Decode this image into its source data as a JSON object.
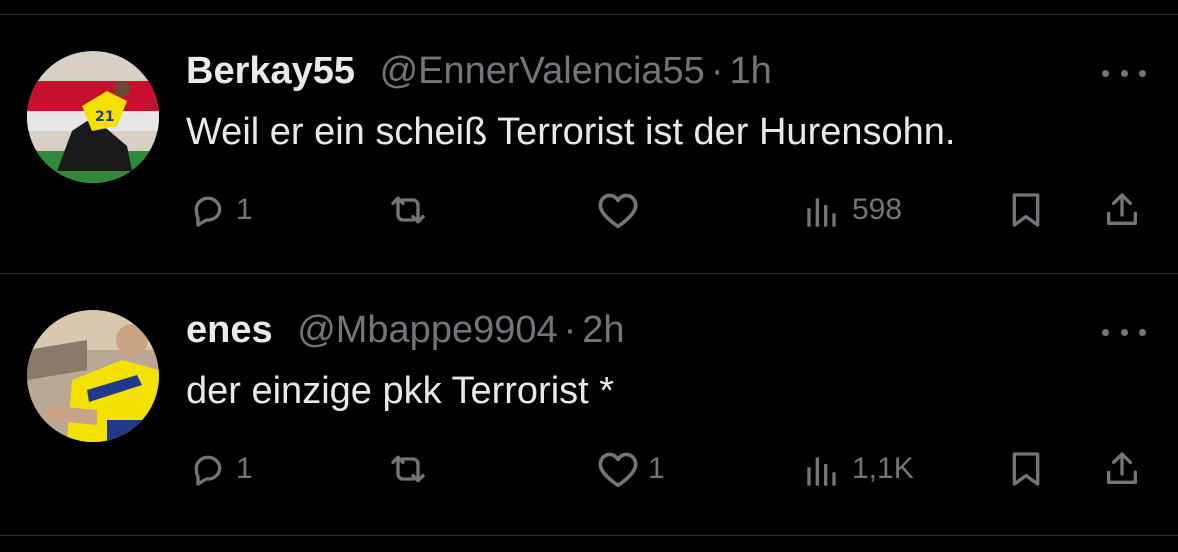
{
  "tweets": [
    {
      "display_name": "Berkay55",
      "handle": "@EnnerValencia55",
      "separator": "·",
      "time": "1h",
      "text": "Weil er ein scheiß Terrorist ist der Hurensohn.",
      "replies": "1",
      "reposts": "",
      "likes": "",
      "views": "598",
      "avatar_colors": [
        "#c8102e",
        "#f5e100",
        "#1a1a1a",
        "#2e8b3a"
      ]
    },
    {
      "display_name": "enes",
      "handle": "@Mbappe9904",
      "separator": "·",
      "time": "2h",
      "text": "der einzige pkk Terrorist *",
      "replies": "1",
      "reposts": "",
      "likes": "1",
      "views": "1,1K",
      "avatar_colors": [
        "#8a7a6a",
        "#f5e100",
        "#1f3a8a",
        "#d9c7b0"
      ]
    }
  ],
  "theme": {
    "background": "#000000",
    "text_primary": "#e7e9ea",
    "text_secondary": "#71767b",
    "divider": "#2f3336"
  },
  "icons": [
    "reply-icon",
    "repost-icon",
    "like-icon",
    "views-icon",
    "bookmark-icon",
    "share-icon",
    "more-icon"
  ]
}
